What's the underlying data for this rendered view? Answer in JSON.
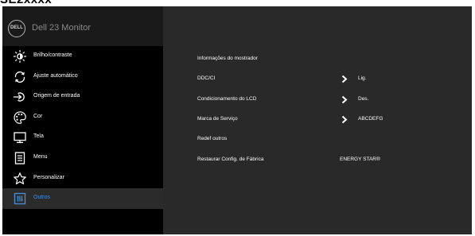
{
  "page": {
    "model_code": "SE2xxxx"
  },
  "header": {
    "logo_text": "DELL",
    "monitor_name": "Dell 23 Monitor"
  },
  "sidebar": {
    "items": [
      {
        "label": "Brilho/contraste",
        "icon": "brightness-icon",
        "active": false
      },
      {
        "label": "Ajuste automático",
        "icon": "auto-adjust-icon",
        "active": false
      },
      {
        "label": "Origem de entrada",
        "icon": "input-source-icon",
        "active": false
      },
      {
        "label": "Cor",
        "icon": "color-icon",
        "active": false
      },
      {
        "label": "Tela",
        "icon": "display-icon",
        "active": false
      },
      {
        "label": "Menu",
        "icon": "menu-icon",
        "active": false
      },
      {
        "label": "Personalizar",
        "icon": "star-icon",
        "active": false
      },
      {
        "label": "Outros",
        "icon": "others-icon",
        "active": true
      }
    ]
  },
  "content": {
    "rows": [
      {
        "label": "Informações do mostrador",
        "value": ""
      },
      {
        "label": "DDC/CI",
        "value": "Lig."
      },
      {
        "label": "Condicionamento do LCD",
        "value": "Des."
      },
      {
        "label": "Marca de Serviço",
        "value": "ABCDEFG"
      },
      {
        "label": "Redef outros",
        "value": ""
      },
      {
        "label": "Restaurar Config. de Fábrica",
        "value": "ENERGY STAR®"
      }
    ]
  },
  "colors": {
    "osd_background": "#000000",
    "header_background": "#1a1a1a",
    "content_background": "#292929",
    "active_item_background": "#2b2b2b",
    "active_item_text": "#4a90d9",
    "text": "#ffffff"
  }
}
